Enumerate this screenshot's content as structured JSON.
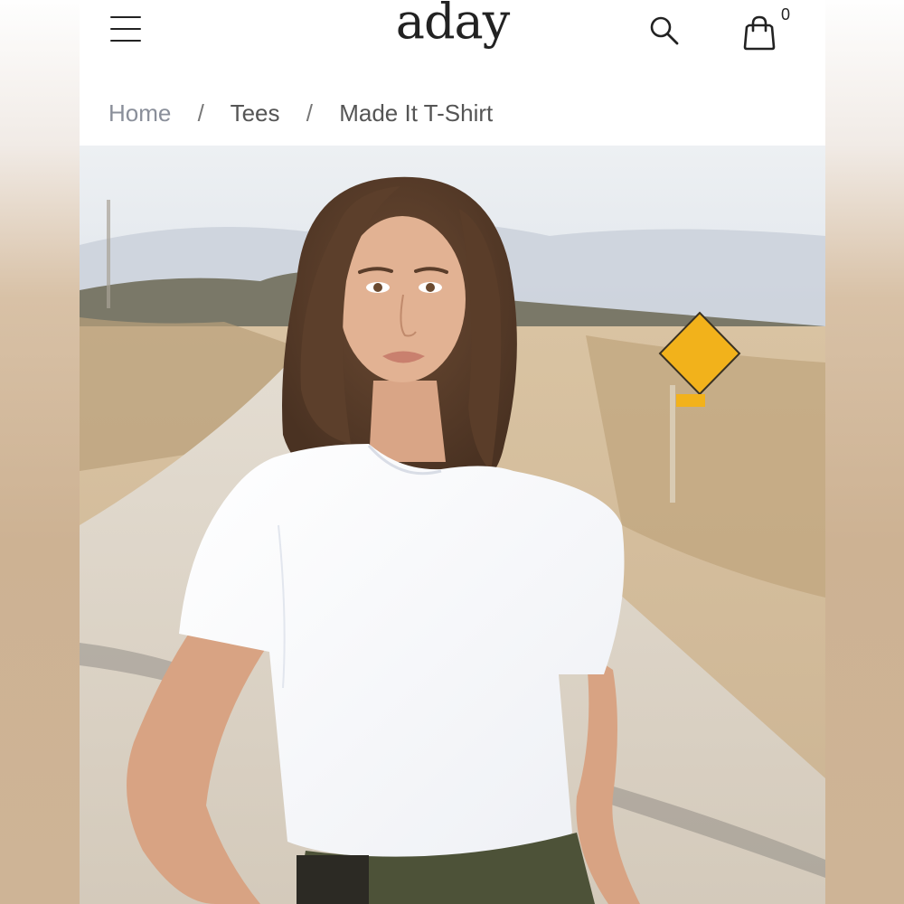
{
  "header": {
    "logo": "aday",
    "menu_icon": "hamburger-menu-icon",
    "search_icon": "search-icon",
    "cart_icon": "shopping-bag-icon",
    "cart_count": "0"
  },
  "breadcrumb": {
    "items": [
      "Home",
      "Tees",
      "Made It T-Shirt"
    ],
    "separator": "/"
  },
  "hero": {
    "image": "product-photo-woman-white-tshirt-desert-road"
  },
  "colors": {
    "text": "#222222",
    "breadcrumb_link": "#8a8f9a",
    "background": "#ffffff"
  }
}
